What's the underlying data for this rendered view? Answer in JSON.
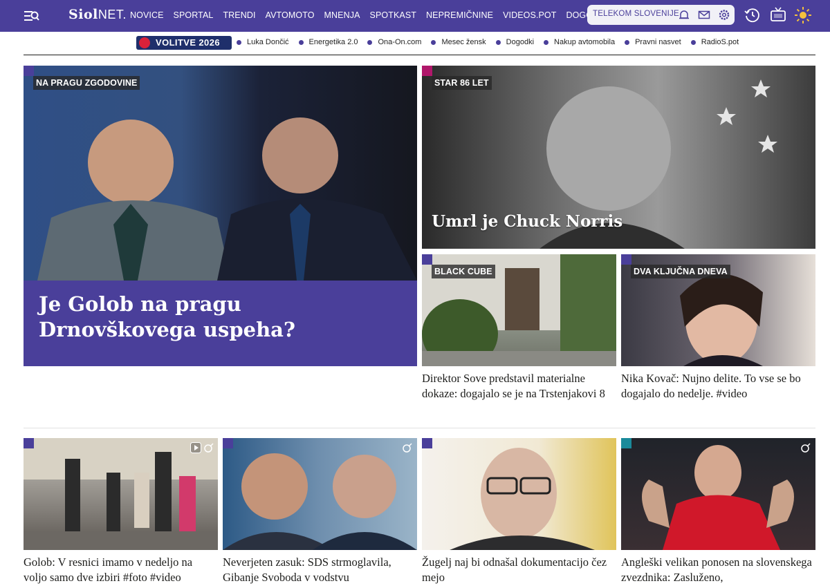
{
  "header": {
    "logo_main": "Siol",
    "logo_suffix": "NET.",
    "nav": [
      "NOVICE",
      "SPORTAL",
      "TRENDI",
      "AVTOMOTO",
      "MNENJA",
      "SPOTKAST",
      "NEPREMIČNINE",
      "VIDEOS.POT",
      "DOGODKI"
    ],
    "telekom_label": "TELEKOM SLOVENIJE",
    "icons": [
      "search-menu-icon",
      "bell-icon",
      "mail-icon",
      "gear-icon",
      "replay-icon",
      "tv-icon",
      "sun-icon"
    ]
  },
  "subnav": {
    "badge": "VOLITVE 2026",
    "links": [
      "Luka Dončić",
      "Energetika 2.0",
      "Ona-On.com",
      "Mesec žensk",
      "Dogodki",
      "Nakup avtomobila",
      "Pravni nasvet",
      "RadioS.pot"
    ]
  },
  "colors": {
    "brand": "#4a3f9a",
    "hero_panel": "#4a3f9a",
    "corner_magenta": "#b0176a",
    "corner_purple": "#4a3f9a",
    "corner_teal": "#1a8a9a"
  },
  "hero": {
    "tag": "NA PRAGU ZGODOVINE",
    "title": "Je Golob na pragu Drnovškovega uspeha?"
  },
  "feature_right": {
    "tag": "STAR 86 LET",
    "title": "Umrl je Chuck Norris"
  },
  "mid_cards": [
    {
      "tag": "BLACK CUBE",
      "title": "Direktor Sove predstavil materialne dokaze: dogajalo se je na Trstenjakovi 8"
    },
    {
      "tag": "DVA KLJUČNA DNEVA",
      "title": "Nika Kovač: Nujno delite. To vse se bo dogajalo do nedelje. #video"
    }
  ],
  "bottom_cards": [
    {
      "title": "Golob: V resnici imamo v nedeljo na voljo samo dve izbiri #foto #video",
      "media": [
        "play-icon",
        "camera-icon"
      ]
    },
    {
      "title": "Neverjeten zasuk: SDS strmoglavila, Gibanje Svoboda v vodstvu",
      "media": [
        "camera-icon"
      ]
    },
    {
      "title": "Žugelj naj bi odnašal dokumentacijo čez mejo",
      "media": []
    },
    {
      "title": "Angleški velikan ponosen na slovenskega zvezdnika: Zasluženo,",
      "media": [
        "camera-icon"
      ]
    }
  ]
}
